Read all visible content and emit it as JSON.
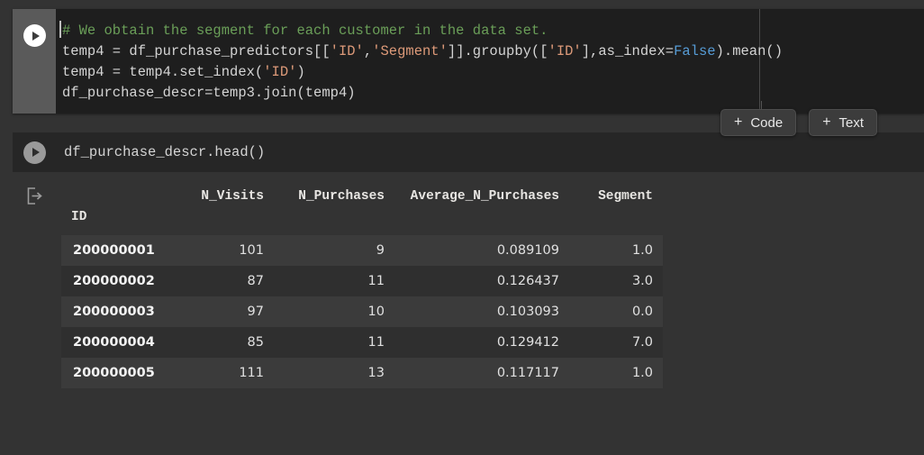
{
  "cells": [
    {
      "type": "code",
      "active": true,
      "run_icon": "play-icon",
      "lines": [
        [
          {
            "t": "comment",
            "s": "# We obtain the segment for each customer in the data set."
          }
        ],
        [
          {
            "t": "plain",
            "s": "temp4 = df_purchase_predictors[["
          },
          {
            "t": "str",
            "s": "'ID'"
          },
          {
            "t": "plain",
            "s": ","
          },
          {
            "t": "str",
            "s": "'Segment'"
          },
          {
            "t": "plain",
            "s": "]].groupby(["
          },
          {
            "t": "str",
            "s": "'ID'"
          },
          {
            "t": "plain",
            "s": "],as_index="
          },
          {
            "t": "kw",
            "s": "False"
          },
          {
            "t": "plain",
            "s": ").mean()"
          }
        ],
        [
          {
            "t": "plain",
            "s": "temp4 = temp4.set_index("
          },
          {
            "t": "str",
            "s": "'ID'"
          },
          {
            "t": "plain",
            "s": ")"
          }
        ],
        [
          {
            "t": "plain",
            "s": "df_purchase_descr=temp3.join(temp4)"
          }
        ]
      ]
    },
    {
      "type": "code",
      "active": false,
      "run_icon": "play-icon",
      "lines": [
        [
          {
            "t": "plain",
            "s": "df_purchase_descr.head()"
          }
        ]
      ]
    }
  ],
  "toolbar": {
    "add_code_label": "Code",
    "add_text_label": "Text",
    "plus_glyph": "+",
    "add_code_icon": "plus-icon",
    "add_text_icon": "plus-icon"
  },
  "output": {
    "icon": "output-arrow-icon",
    "table": {
      "index_name": "ID",
      "columns": [
        "N_Visits",
        "N_Purchases",
        "Average_N_Purchases",
        "Segment"
      ],
      "rows": [
        {
          "id": "200000001",
          "values": [
            "101",
            "9",
            "0.089109",
            "1.0"
          ]
        },
        {
          "id": "200000002",
          "values": [
            "87",
            "11",
            "0.126437",
            "3.0"
          ]
        },
        {
          "id": "200000003",
          "values": [
            "97",
            "10",
            "0.103093",
            "0.0"
          ]
        },
        {
          "id": "200000004",
          "values": [
            "85",
            "11",
            "0.129412",
            "7.0"
          ]
        },
        {
          "id": "200000005",
          "values": [
            "111",
            "13",
            "0.117117",
            "1.0"
          ]
        }
      ]
    }
  },
  "colors": {
    "page_background": "#333333",
    "code_cell_active_bg": "#1e1e1e",
    "code_cell_bg": "#262626",
    "gutter_active": "#5a5a5a",
    "comment": "#6a9e58",
    "string": "#dd9a79",
    "keyword": "#569cd6",
    "code_text": "#d4d4d4",
    "row_odd": "#3b3b3b",
    "row_even": "#2f2f2f"
  }
}
